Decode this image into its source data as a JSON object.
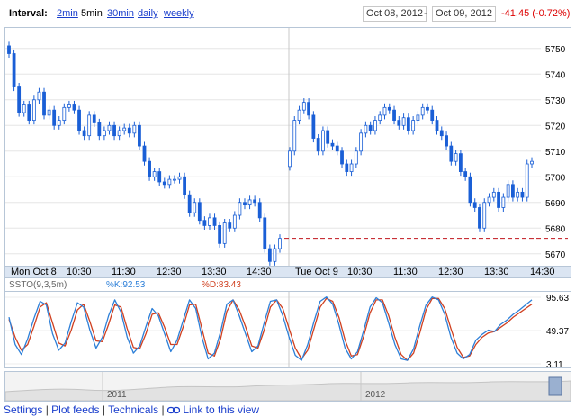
{
  "toolbar": {
    "interval_label": "Interval:",
    "intervals": [
      "2min",
      "5min",
      "30min",
      "daily",
      "weekly"
    ],
    "current_interval": "5min",
    "date_from": "Oct 08, 2012",
    "range_separator": "-",
    "date_to": "Oct 09, 2012",
    "change": "-41.45 (-0.72%)"
  },
  "main_chart": {
    "y_ticks": [
      "5750",
      "5740",
      "5730",
      "5720",
      "5710",
      "5700",
      "5690",
      "5680",
      "5670"
    ],
    "x_labels": [
      "Mon Oct 8",
      "10:30",
      "11:30",
      "12:30",
      "13:30",
      "14:30",
      "Tue Oct 9",
      "10:30",
      "11:30",
      "12:30",
      "13:30",
      "14:30"
    ],
    "previous_close_line": 5676,
    "colors": {
      "candle": "#1a5fd6",
      "prev_close": "#c0141c",
      "grid": "#e6e6e6"
    }
  },
  "stochastic": {
    "name": "SSTO(9,3,5m)",
    "k_label": "%K:92.53",
    "d_label": "%D:83.43",
    "y_ticks": [
      "95.63",
      "49.37",
      "3.11"
    ],
    "colors": {
      "k": "#2c7fd8",
      "d": "#d04020"
    }
  },
  "navigator": {
    "years": [
      "2011",
      "2012"
    ]
  },
  "footer": {
    "settings": "Settings",
    "plot_feeds": "Plot feeds",
    "technicals": "Technicals",
    "link_icon": "link-icon",
    "link_to_view": "Link to this view"
  },
  "chart_data": {
    "type": "candlestick",
    "y_unit": "index points",
    "ylim": [
      5665,
      5758
    ],
    "days": [
      {
        "label": "Mon Oct 8",
        "close": [
          5748,
          5735,
          5725,
          5728,
          5722,
          5730,
          5733,
          5724,
          5726,
          5720,
          5722,
          5727,
          5728,
          5726,
          5718,
          5716,
          5724,
          5721,
          5716,
          5718,
          5720,
          5716,
          5718,
          5719,
          5717,
          5720,
          5712,
          5706,
          5700,
          5702,
          5698,
          5697,
          5699,
          5699,
          5700,
          5693,
          5686,
          5690,
          5683,
          5681,
          5684,
          5681,
          5674,
          5682,
          5680,
          5685,
          5690,
          5689,
          5691,
          5690,
          5684,
          5672,
          5667,
          5672,
          5676
        ]
      },
      {
        "label": "Tue Oct 9",
        "close": [
          5710,
          5722,
          5726,
          5729,
          5724,
          5715,
          5710,
          5718,
          5713,
          5712,
          5710,
          5705,
          5702,
          5705,
          5710,
          5717,
          5720,
          5718,
          5722,
          5724,
          5727,
          5726,
          5722,
          5720,
          5723,
          5718,
          5722,
          5724,
          5727,
          5726,
          5722,
          5718,
          5716,
          5712,
          5706,
          5709,
          5702,
          5700,
          5690,
          5688,
          5680,
          5690,
          5692,
          5694,
          5688,
          5692,
          5697,
          5692,
          5694,
          5692,
          5705,
          5706
        ]
      }
    ]
  },
  "stochastic_data": {
    "k": [
      68,
      30,
      16,
      38,
      66,
      90,
      85,
      45,
      22,
      32,
      62,
      88,
      82,
      50,
      25,
      40,
      70,
      92,
      75,
      40,
      18,
      28,
      55,
      80,
      70,
      45,
      20,
      36,
      64,
      92,
      80,
      40,
      10,
      18,
      48,
      86,
      92,
      70,
      45,
      20,
      28,
      60,
      90,
      92,
      70,
      40,
      15,
      8,
      30,
      62,
      90,
      96,
      86,
      58,
      25,
      10,
      20,
      50,
      82,
      95,
      88,
      60,
      30,
      10,
      8,
      24,
      56,
      85,
      96,
      92,
      72,
      40,
      18,
      10,
      16,
      36,
      44,
      50,
      48,
      58,
      64,
      72,
      78,
      85,
      92
    ],
    "d": [
      65,
      40,
      22,
      30,
      55,
      82,
      88,
      60,
      32,
      28,
      50,
      78,
      86,
      62,
      35,
      34,
      58,
      85,
      82,
      52,
      26,
      24,
      45,
      72,
      74,
      54,
      30,
      30,
      55,
      85,
      86,
      52,
      18,
      14,
      38,
      76,
      92,
      78,
      55,
      28,
      25,
      50,
      82,
      92,
      80,
      52,
      25,
      10,
      22,
      52,
      82,
      94,
      90,
      68,
      36,
      14,
      16,
      42,
      74,
      92,
      92,
      70,
      40,
      16,
      8,
      18,
      46,
      78,
      94,
      94,
      80,
      52,
      26,
      12,
      14,
      30,
      40,
      46,
      48,
      54,
      60,
      68,
      74,
      80,
      86
    ]
  }
}
